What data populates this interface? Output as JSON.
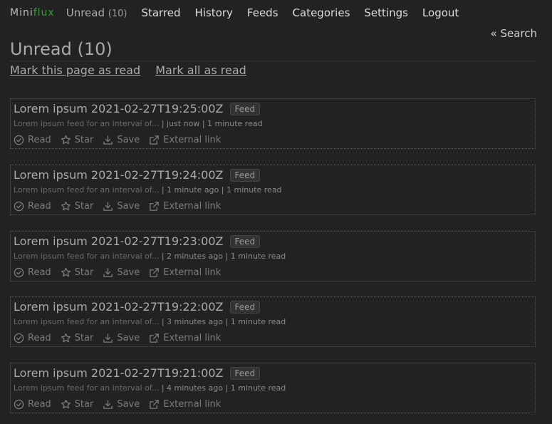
{
  "app": {
    "logo_part1": "Mini",
    "logo_part2": "flux"
  },
  "nav": {
    "unread_label": "Unread",
    "unread_count": "(10)",
    "starred": "Starred",
    "history": "History",
    "feeds": "Feeds",
    "categories": "Categories",
    "settings": "Settings",
    "logout": "Logout"
  },
  "search_link": "« Search",
  "page": {
    "title": "Unread (10)",
    "mark_page_read": "Mark this page as read",
    "mark_all_read": "Mark all as read"
  },
  "entry_actions": {
    "read": "Read",
    "star": "Star",
    "save": "Save",
    "external": "External link"
  },
  "icons": {
    "read": "check-circle-icon",
    "star": "star-icon",
    "save": "download-icon",
    "external": "external-link-icon"
  },
  "colors": {
    "background": "#222222",
    "logo_accent": "#3a9a3a"
  },
  "entries": [
    {
      "title": "Lorem ipsum 2021-02-27T19:25:00Z",
      "badge": "Feed",
      "feed": "Lorem ipsum feed for an interval of...",
      "time": "just now",
      "reading_time": "1 minute read"
    },
    {
      "title": "Lorem ipsum 2021-02-27T19:24:00Z",
      "badge": "Feed",
      "feed": "Lorem ipsum feed for an interval of...",
      "time": "1 minute ago",
      "reading_time": "1 minute read"
    },
    {
      "title": "Lorem ipsum 2021-02-27T19:23:00Z",
      "badge": "Feed",
      "feed": "Lorem ipsum feed for an interval of...",
      "time": "2 minutes ago",
      "reading_time": "1 minute read"
    },
    {
      "title": "Lorem ipsum 2021-02-27T19:22:00Z",
      "badge": "Feed",
      "feed": "Lorem ipsum feed for an interval of...",
      "time": "3 minutes ago",
      "reading_time": "1 minute read"
    },
    {
      "title": "Lorem ipsum 2021-02-27T19:21:00Z",
      "badge": "Feed",
      "feed": "Lorem ipsum feed for an interval of...",
      "time": "4 minutes ago",
      "reading_time": "1 minute read"
    }
  ]
}
